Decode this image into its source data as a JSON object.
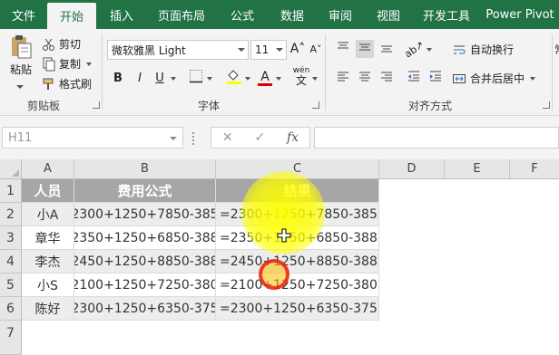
{
  "tabs": [
    {
      "label": "文件",
      "active": false
    },
    {
      "label": "开始",
      "active": true
    },
    {
      "label": "插入",
      "active": false
    },
    {
      "label": "页面布局",
      "active": false
    },
    {
      "label": "公式",
      "active": false
    },
    {
      "label": "数据",
      "active": false
    },
    {
      "label": "审阅",
      "active": false
    },
    {
      "label": "视图",
      "active": false
    },
    {
      "label": "开发工具",
      "active": false
    },
    {
      "label": "Power Pivot",
      "active": false
    }
  ],
  "clipboard": {
    "paste": "粘贴",
    "cut": "剪切",
    "copy": "复制",
    "format_painter": "格式刷",
    "group": "剪贴板"
  },
  "font": {
    "name": "微软雅黑 Light",
    "size": "11",
    "bold": "B",
    "italic": "I",
    "underline": "U",
    "group": "字体",
    "phonetic": "wén"
  },
  "alignment": {
    "wrap_text": "自动换行",
    "merge_center": "合并后居中",
    "group": "对齐方式"
  },
  "number": {
    "partial": "常"
  },
  "formula_bar": {
    "name_box": "H11",
    "fx": "fx",
    "value": ""
  },
  "columns": [
    "A",
    "B",
    "C",
    "D",
    "E",
    "F"
  ],
  "rows": [
    "1",
    "2",
    "3",
    "4",
    "5",
    "6",
    "7"
  ],
  "table": {
    "headers": [
      "人员",
      "费用公式",
      "结果"
    ],
    "rows": [
      [
        "小A",
        "2300+1250+7850-385",
        "=2300+1250+7850-385"
      ],
      [
        "章华",
        "2350+1250+6850-388",
        "=2350+1250+6850-388"
      ],
      [
        "李杰",
        "2450+1250+8850-388",
        "=2450+1250+8850-388"
      ],
      [
        "小S",
        "2100+1250+7250-380",
        "=2100+1250+7250-380"
      ],
      [
        "陈好",
        "2300+1250+6350-375",
        "=2300+1250+6350-375"
      ]
    ]
  },
  "colors": {
    "ribbon_green": "#217346",
    "header_fill": "#a6a6a6",
    "band_fill": "#ededed"
  }
}
